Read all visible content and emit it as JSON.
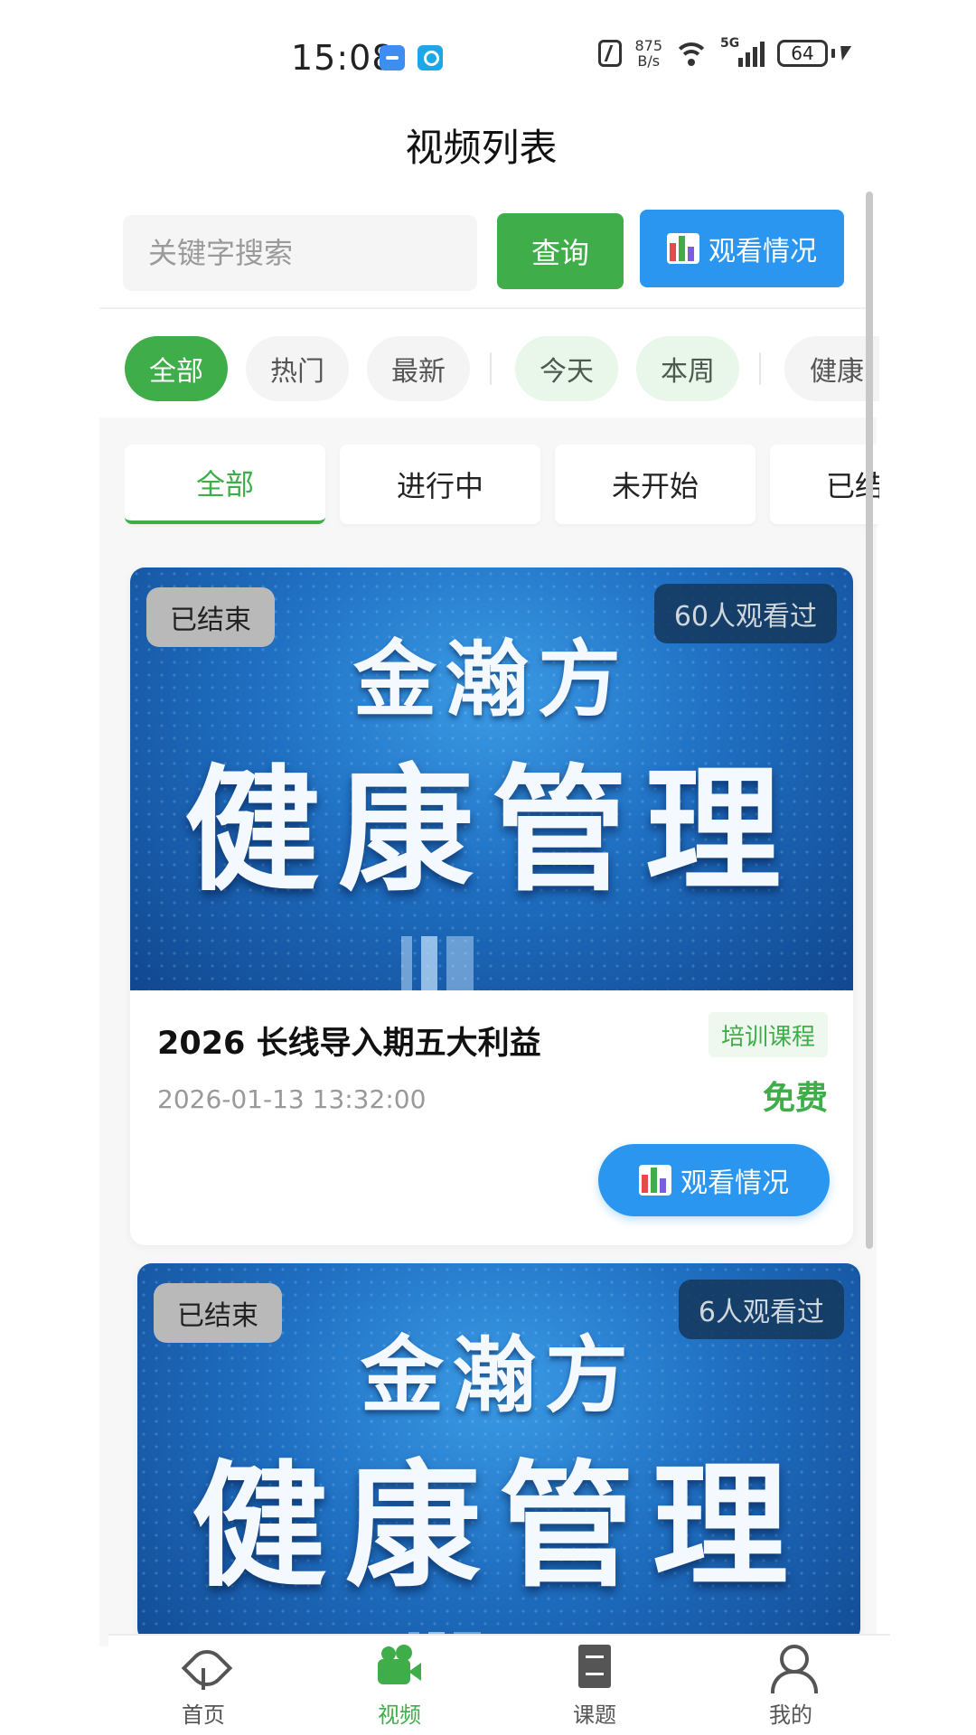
{
  "status_bar": {
    "time": "15:08",
    "net_speed_value": "875",
    "net_speed_unit": "B/s",
    "signal_label": "5G",
    "battery": "64"
  },
  "header": {
    "title": "视频列表"
  },
  "search": {
    "placeholder": "关键字搜索",
    "query_label": "查询",
    "watch_status_label": "观看情况"
  },
  "filter_chips": [
    {
      "label": "全部",
      "active": true
    },
    {
      "label": "热门"
    },
    {
      "label": "最新"
    },
    {
      "label": "今天"
    },
    {
      "label": "本周"
    },
    {
      "label": "健康"
    }
  ],
  "status_tabs": [
    {
      "label": "全部",
      "active": true
    },
    {
      "label": "进行中"
    },
    {
      "label": "未开始"
    },
    {
      "label": "已结"
    }
  ],
  "videos": [
    {
      "status_badge": "已结束",
      "viewers": "60人观看过",
      "thumb_brand": "金瀚方",
      "thumb_headline": "健康管理",
      "title": "2026 长线导入期五大利益",
      "tag": "培训课程",
      "date": "2026-01-13 13:32:00",
      "price": "免费",
      "watch_label": "观看情况"
    },
    {
      "status_badge": "已结束",
      "viewers": "6人观看过",
      "thumb_brand": "金瀚方",
      "thumb_headline": "健康管理"
    }
  ],
  "bottom_nav": [
    {
      "label": "首页",
      "icon": "home-icon"
    },
    {
      "label": "视频",
      "icon": "video-icon",
      "active": true
    },
    {
      "label": "课题",
      "icon": "book-icon"
    },
    {
      "label": "我的",
      "icon": "user-icon"
    }
  ],
  "colors": {
    "primary_green": "#3fae4a",
    "primary_blue": "#2a96ef",
    "badge_gray": "#b9b9b9"
  }
}
